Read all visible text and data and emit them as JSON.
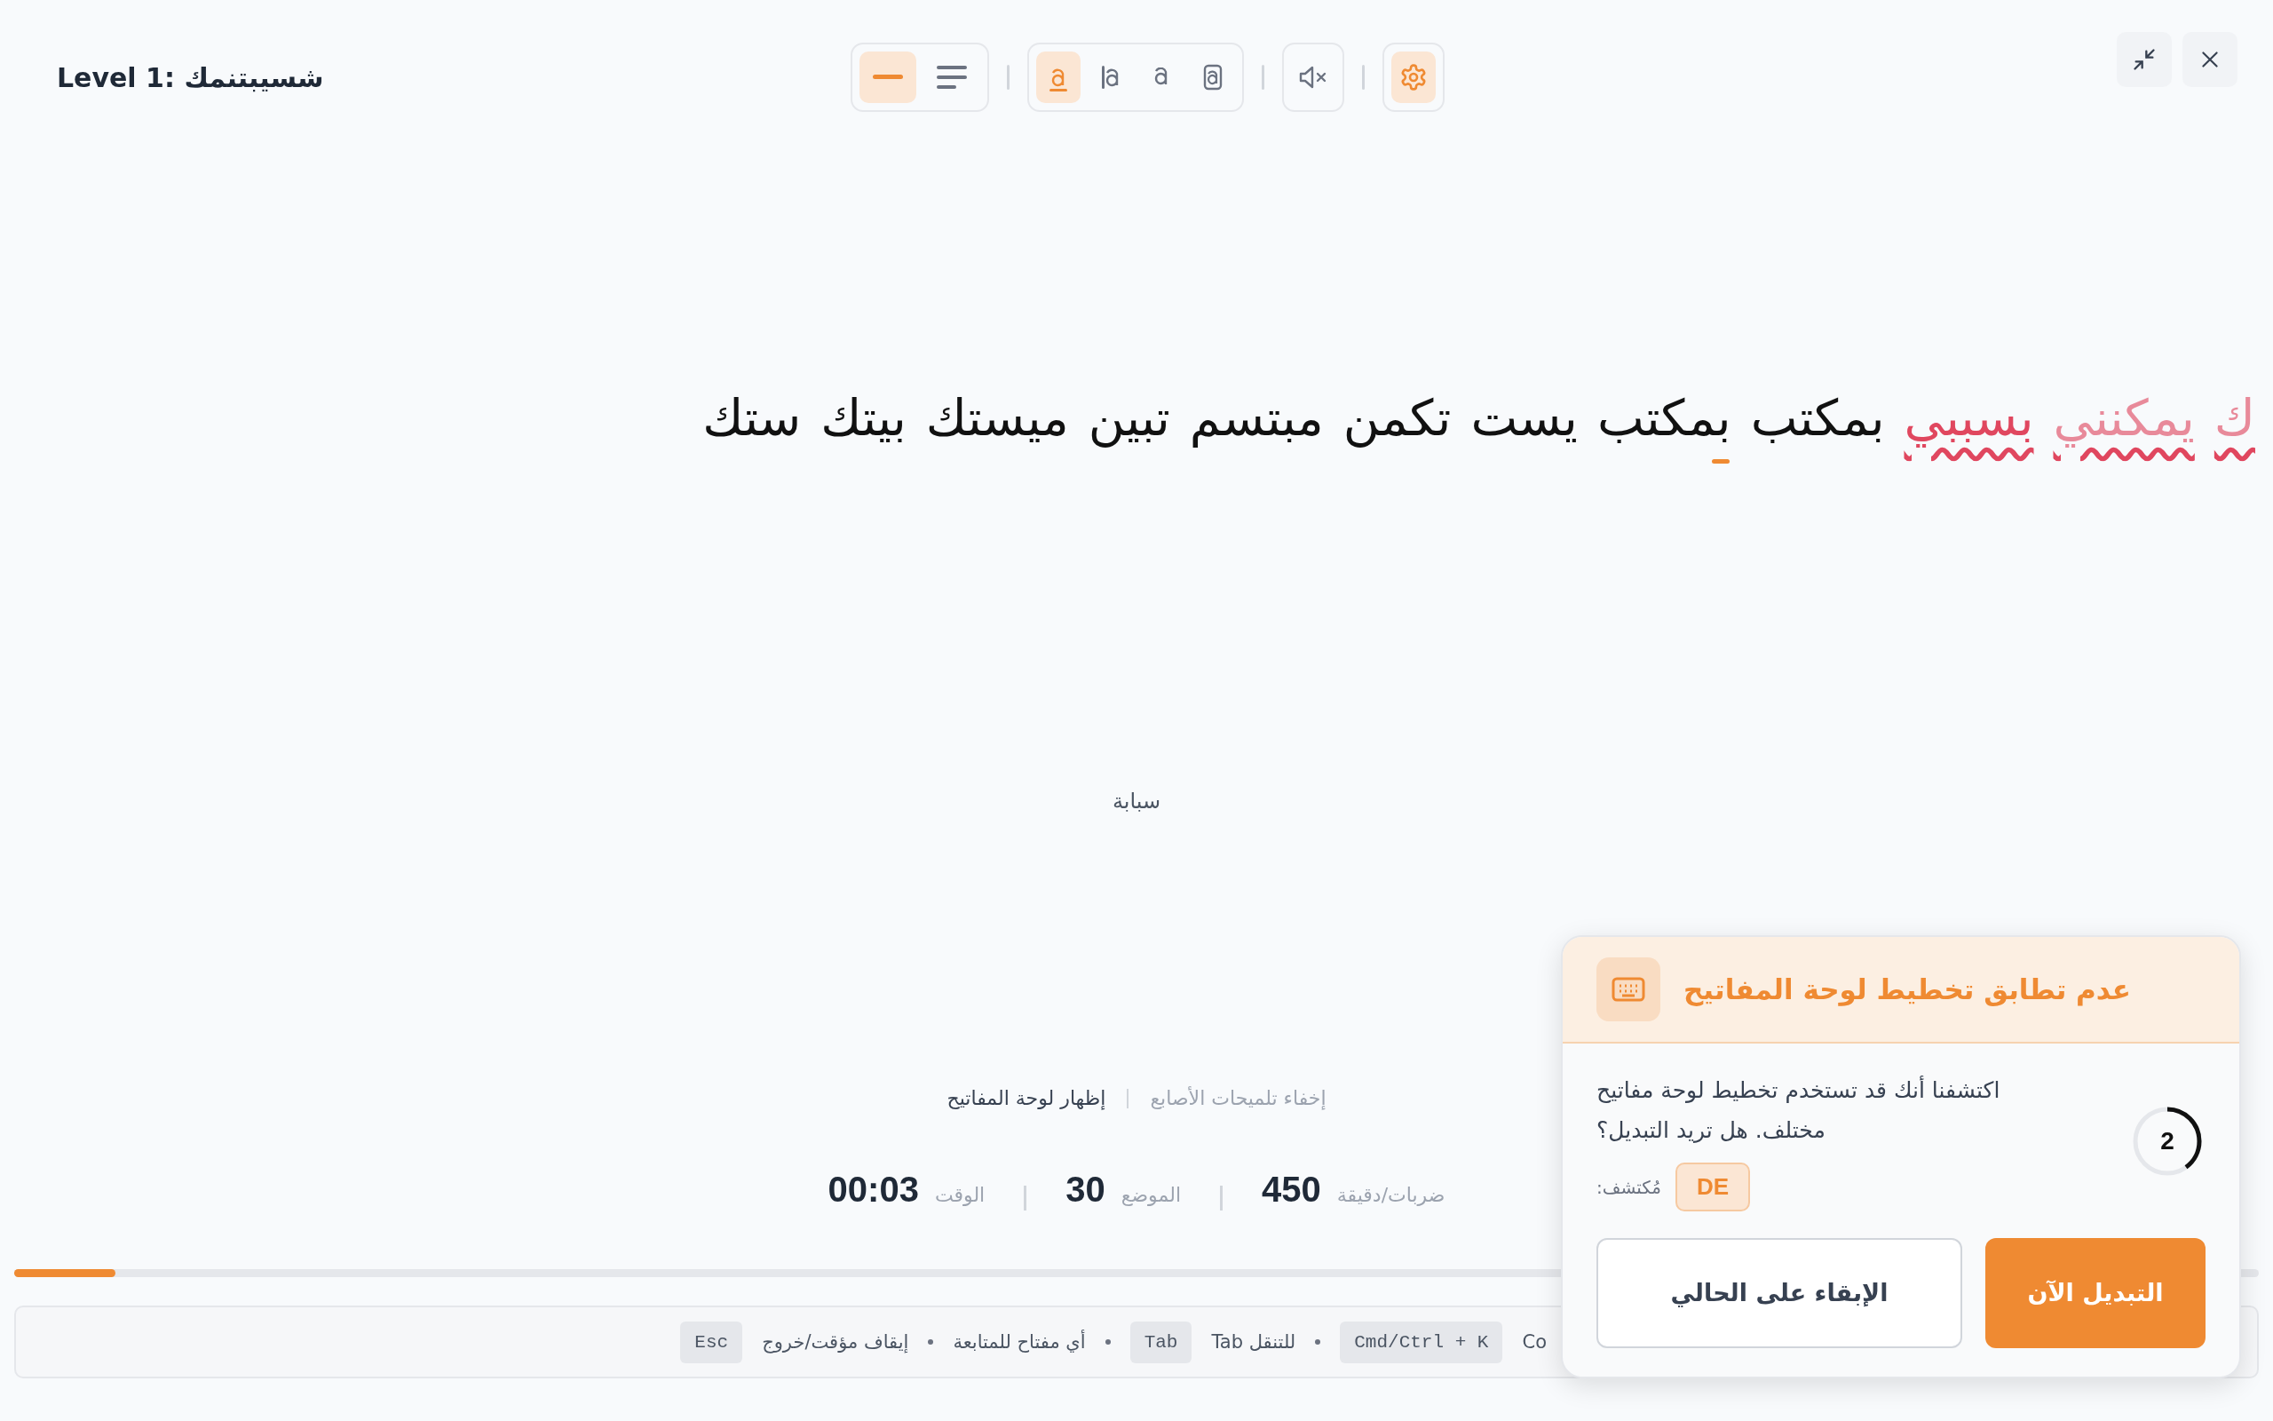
{
  "title": "Level 1: شسيبتنمك",
  "toolbar": [
    {
      "buttons": [
        {
          "kind": "line",
          "selected": true
        },
        {
          "kind": "paragraph",
          "selected": false
        }
      ]
    },
    {
      "buttons": [
        {
          "kind": "cursor-underline",
          "selected": true
        },
        {
          "kind": "cursor-bar",
          "selected": false
        },
        {
          "kind": "cursor-none",
          "selected": false
        },
        {
          "kind": "cursor-box",
          "selected": false
        }
      ]
    },
    {
      "buttons": [
        {
          "kind": "mute",
          "selected": false
        }
      ]
    },
    {
      "buttons": [
        {
          "kind": "settings",
          "selected": true
        }
      ]
    }
  ],
  "words": [
    {
      "text": "ك",
      "error": true,
      "current": false,
      "faded": true
    },
    {
      "text": "يمكنني",
      "error": true,
      "current": false,
      "faded": true
    },
    {
      "text": "بسببي",
      "error": true,
      "current": false,
      "faded": false
    },
    {
      "text": "بمكتب",
      "error": false,
      "current": false,
      "faded": false
    },
    {
      "text": "بمكتب",
      "error": false,
      "current": true,
      "faded": false
    },
    {
      "text": "يست",
      "error": false,
      "current": false,
      "faded": false
    },
    {
      "text": "تكمن",
      "error": false,
      "current": false,
      "faded": false
    },
    {
      "text": "مبتسم",
      "error": false,
      "current": false,
      "faded": false
    },
    {
      "text": "تبين",
      "error": false,
      "current": false,
      "faded": false
    },
    {
      "text": "ميستك",
      "error": false,
      "current": false,
      "faded": false
    },
    {
      "text": "بيتك",
      "error": false,
      "current": false,
      "faded": false
    },
    {
      "text": "ستك",
      "error": false,
      "current": false,
      "faded": false
    }
  ],
  "finger_hint": "سبابة",
  "links": [
    {
      "text": "إخفاء تلميحات الأصابع",
      "highlighted": false
    },
    {
      "text": "إظهار لوحة المفاتيح",
      "highlighted": true
    }
  ],
  "stats": [
    {
      "label": "ضربات/دقيقة",
      "value": "450"
    },
    {
      "label": "الموضع",
      "value": "30"
    },
    {
      "label": "الوقت",
      "value": "00:03"
    }
  ],
  "progress": {
    "level": 0.045
  },
  "shortcuts": [
    {
      "label": "Co",
      "key": "Cmd/Ctrl + K"
    },
    {
      "label": "للتنقل Tab",
      "key": "Tab"
    },
    {
      "label": "أي مفتاح للمتابعة"
    },
    {
      "label": "إيقاف مؤقت/خروج",
      "key": "Esc"
    }
  ],
  "dialog": {
    "title": "عدم تطابق تخطيط لوحة المفاتيح",
    "message": "اكتشفنا أنك قد تستخدم تخطيط لوحة مفاتيح مختلف. هل تريد التبديل؟",
    "countdown": {
      "value": "2",
      "level": 0.4
    },
    "detected_label": "مُكتشف:",
    "detected_value": "DE",
    "primary_button": "التبديل الآن",
    "secondary_button": "الإبقاء على الحالي"
  }
}
